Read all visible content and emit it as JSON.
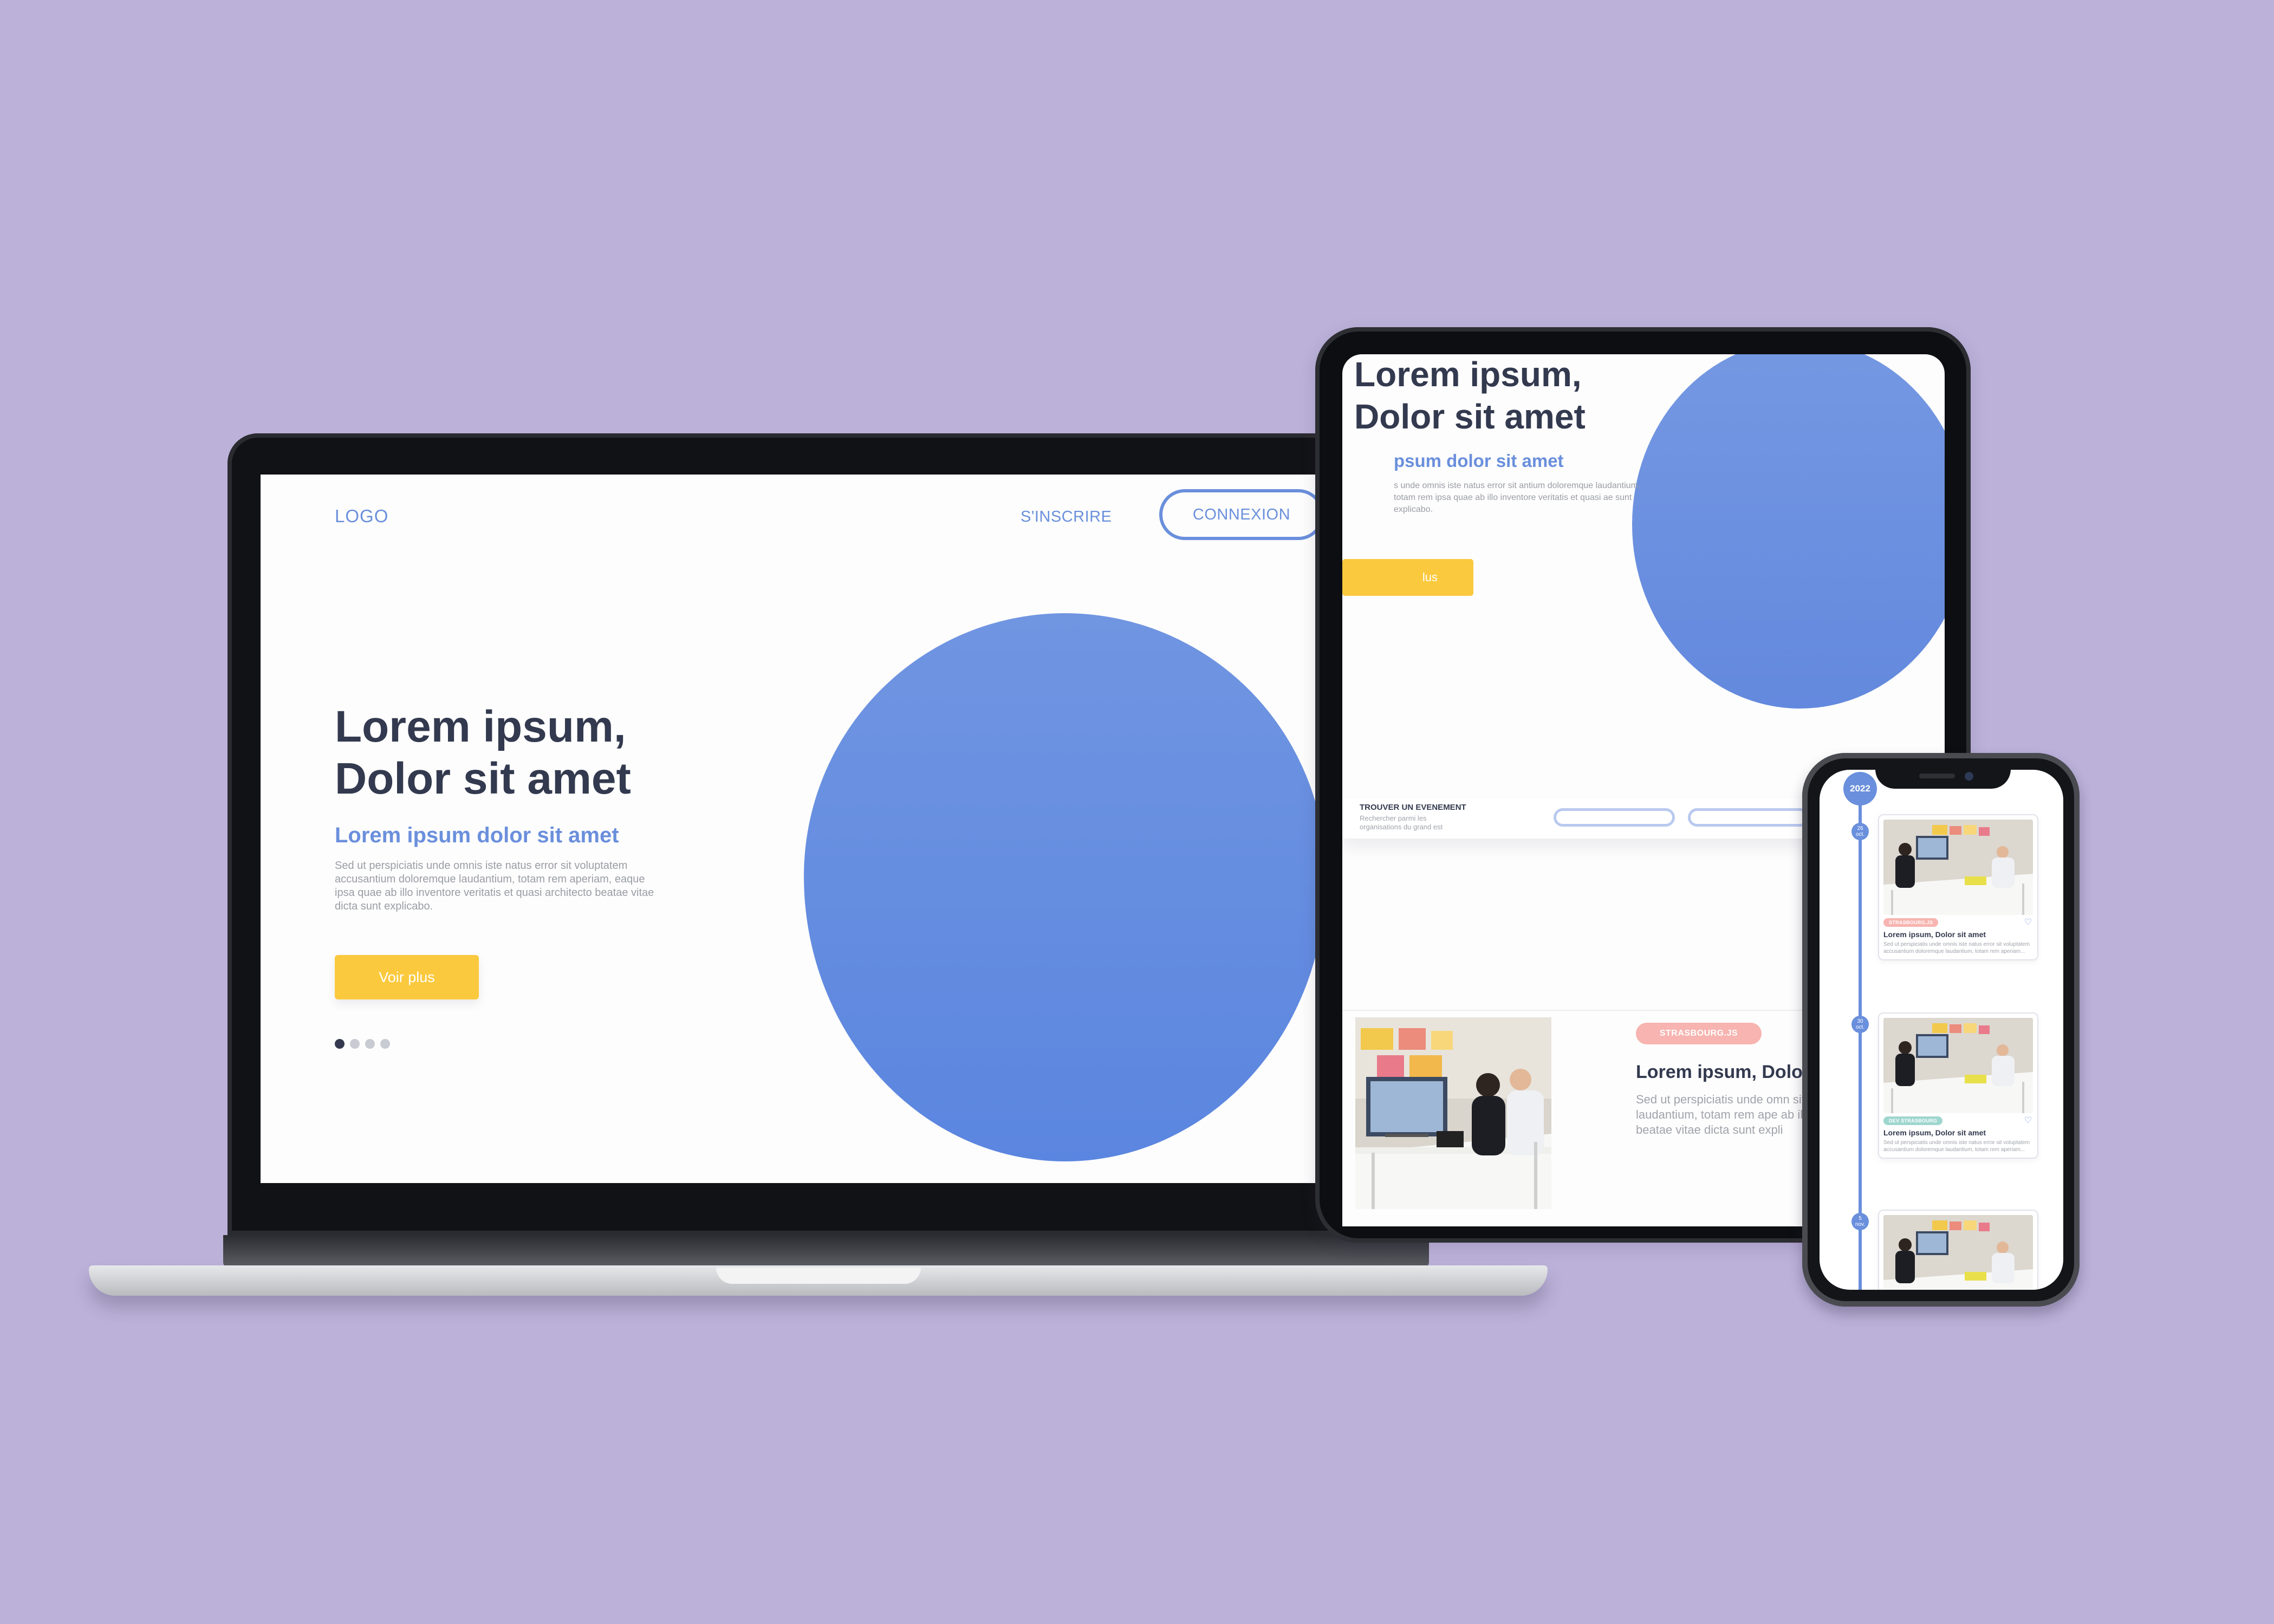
{
  "laptop": {
    "logo": "LOGO",
    "signup_label": "S'INSCRIRE",
    "login_label": "CONNEXION",
    "headline_line1": "Lorem ipsum,",
    "headline_line2": "Dolor sit amet",
    "subheadline": "Lorem ipsum dolor sit amet",
    "body": "Sed ut perspiciatis unde omnis iste natus error sit voluptatem accusantium doloremque laudantium, totam rem aperiam, eaque ipsa quae ab illo inventore veritatis et quasi architecto beatae vitae dicta sunt explicabo.",
    "cta_label": "Voir plus",
    "carousel": {
      "total": 4,
      "active": 1
    }
  },
  "tablet": {
    "headline_line1": "Lorem ipsum,",
    "headline_line2": "Dolor sit amet",
    "subheadline": "psum dolor sit amet",
    "body": "s unde omnis iste natus error sit antium doloremque laudantium, totam rem ipsa quae ab illo inventore veritatis et quasi ae sunt explicabo.",
    "cta_label": "lus",
    "search_title": "TROUVER UN EVENEMENT",
    "search_subtitle": "Rechercher parmi les organisations du grand est",
    "card": {
      "tag": "STRASBOURG.JS",
      "title": "Lorem ipsum, Dolo",
      "text": "Sed ut perspiciatis unde omn sit voluptatem accusantium laudantium, totam rem ape ab illo inventore veritatis et q beatae vitae dicta sunt expli"
    }
  },
  "phone": {
    "year": "2022",
    "cards": [
      {
        "date_day": "26",
        "date_month": "oct.",
        "tag": "STRASBOURG.JS",
        "tag_color": "#f7b4b0",
        "title": "Lorem ipsum, Dolor sit amet",
        "text": "Sed ut perspiciatis unde omnis iste natus error sit voluptatem accusantium doloremque laudantium, totam rem aperiam..."
      },
      {
        "date_day": "30",
        "date_month": "oct.",
        "tag": "DEV STRASBOURG",
        "tag_color": "#9fd6cf",
        "title": "Lorem ipsum, Dolor sit amet",
        "text": "Sed ut perspiciatis unde omnis iste natus error sit voluptatem accusantium doloremque laudantium, totam rem aperiam..."
      },
      {
        "date_day": "5",
        "date_month": "nov."
      }
    ]
  },
  "colors": {
    "background": "#bbb1d9",
    "accent": "#6a8fdc",
    "cta": "#fbc93d",
    "heading": "#333a4f"
  }
}
